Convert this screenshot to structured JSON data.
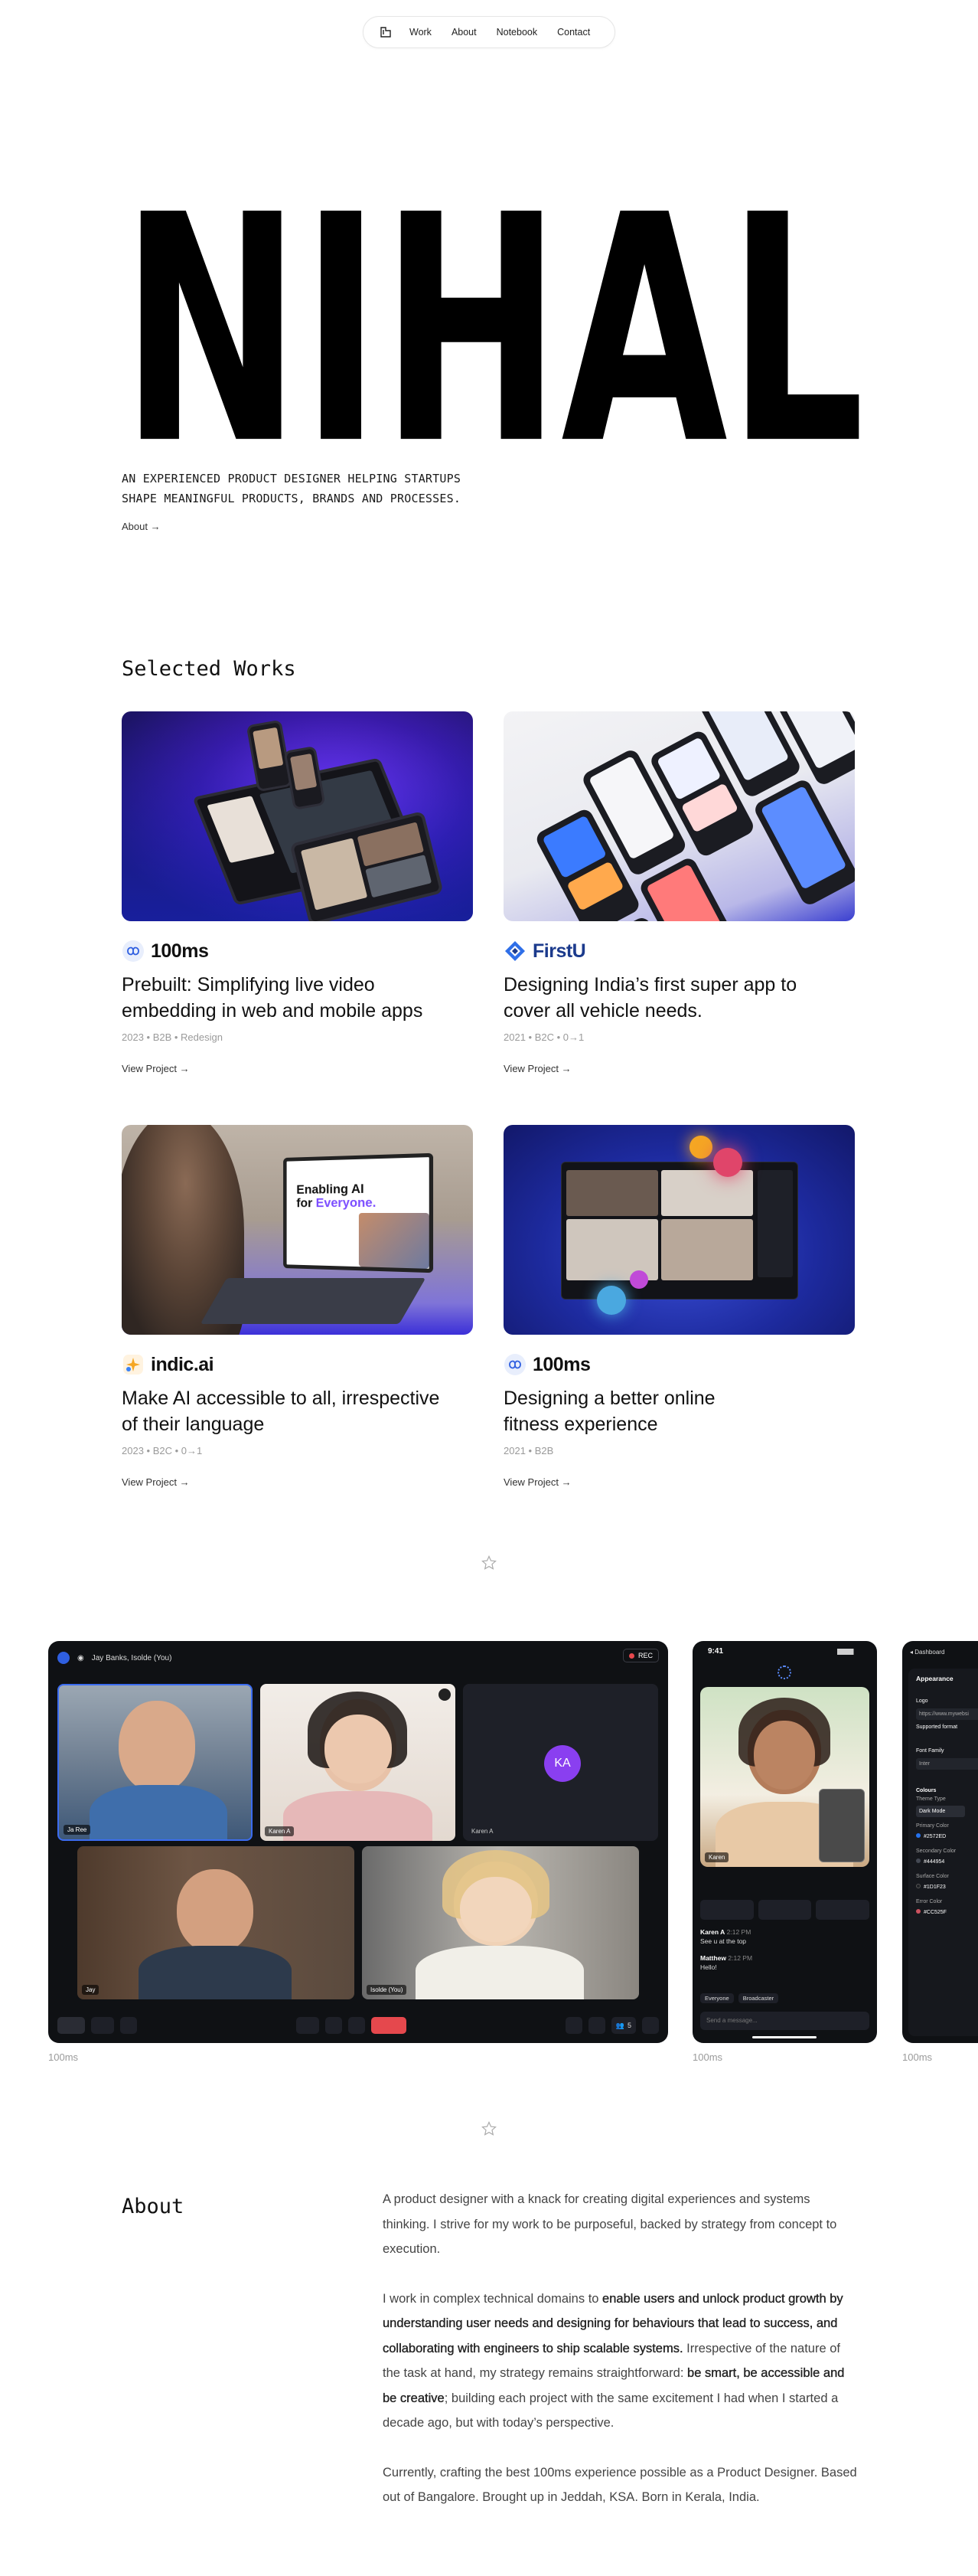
{
  "nav": {
    "items": [
      "Work",
      "About",
      "Notebook",
      "Contact"
    ]
  },
  "hero": {
    "name": "NIHAL",
    "tagline_line1": "AN EXPERIENCED PRODUCT DESIGNER HELPING STARTUPS",
    "tagline_line2": "SHAPE MEANINGFUL PRODUCTS, BRANDS AND PROCESSES.",
    "about_link": "About →"
  },
  "works": {
    "title": "Selected Works",
    "items": [
      {
        "brand": "100ms",
        "title": "Prebuilt: Simplifying live video embedding in web and mobile apps",
        "meta": "2023 • B2B • Redesign",
        "cta": "View Project →"
      },
      {
        "brand": "FirstU",
        "title": "Designing India’s first super app to cover all vehicle needs.",
        "meta": "2021 • B2C • 0→1",
        "cta": "View Project →"
      },
      {
        "brand": "indic.ai",
        "title": "Make AI accessible to all, irrespective of their language",
        "meta": "2023 • B2C • 0→1",
        "cta": "View Project →"
      },
      {
        "brand": "100ms",
        "title": "Designing a better online fitness experience",
        "meta": "2021 • B2B",
        "cta": "View Project →"
      }
    ],
    "indic_screen": {
      "line1": "Enabling AI",
      "line2": "for",
      "line2b": "Everyone."
    }
  },
  "gallery": {
    "call": {
      "participants_label": "Jay Banks, Isolde (You)",
      "rec": "REC",
      "tiles": [
        "Ja Ree",
        "Karen A",
        "Karen A",
        "Jay",
        "Isolde (You)"
      ],
      "avatar_initials": "KA",
      "people_count": "5"
    },
    "mobile": {
      "time": "9:41",
      "tile_name": "Karen",
      "chat": [
        {
          "name": "Karen A",
          "time": "2:12 PM",
          "msg": "See u at the top"
        },
        {
          "name": "Matthew",
          "time": "2:12 PM",
          "msg": "Hello!"
        }
      ],
      "filters": [
        "Everyone",
        "Broadcaster"
      ],
      "input_placeholder": "Send a message..."
    },
    "dashboard": {
      "header": "Dashboard",
      "panel": "Appearance",
      "logo": "Logo",
      "url": "https://www.mywebsi",
      "supported": "Supported format",
      "font_family": "Font Family",
      "font_value": "Inter",
      "colours": "Colours",
      "theme_type": "Theme Type",
      "theme_value": "Dark Mode",
      "primary": "Primary Color",
      "primary_val": "#2572ED",
      "secondary": "Secondary Color",
      "secondary_val": "#444954",
      "surface": "Surface Color",
      "surface_val": "#1D1F23",
      "error": "Error Color",
      "error_val": "#CC525F"
    },
    "captions": [
      "100ms",
      "100ms",
      "100ms"
    ]
  },
  "about": {
    "title": "About",
    "p1": "A product designer with a knack for creating digital experiences and systems thinking. I strive for my work to be purposeful, backed by strategy from concept to execution.",
    "p2a": "I work in complex technical domains to ",
    "p2b": "enable users and unlock product growth by understanding user needs and designing for behaviours that lead to success, and collaborating with engineers to ship scalable systems.",
    "p2c": " Irrespective of the nature of the task at hand, my strategy remains straightforward: ",
    "p2d": "be smart, be accessible and be creative",
    "p2e": "; building each project with the same excitement I had when I started a decade ago, but with today’s perspective.",
    "p3": "Currently, crafting the best 100ms experience possible as a Product Designer. Based out of Bangalore. Brought up in Jeddah, KSA. Born in Kerala, India."
  },
  "colors": {
    "accent_purple": "#5b2fd6",
    "accent_blue": "#1d3fd6",
    "rec_red": "#e5484d",
    "avatar_purple": "#8a3ff0"
  }
}
